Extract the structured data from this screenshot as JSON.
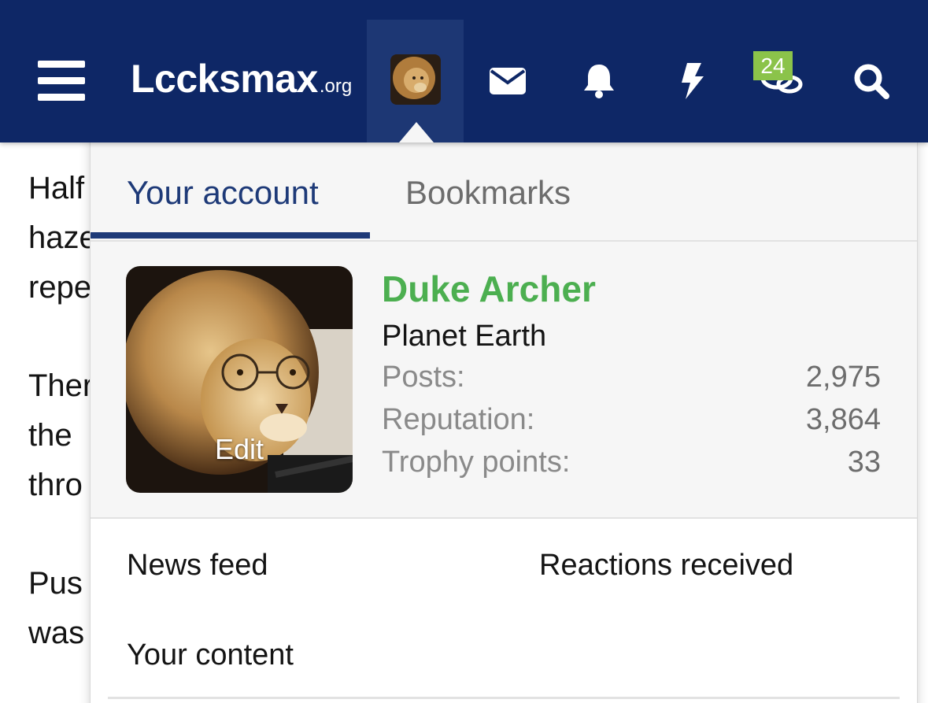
{
  "colors": {
    "navbar_bg": "#0e2766",
    "active_tab_bg": "#1d3774",
    "accent_blue": "#1e3a78",
    "username_green": "#4caf50",
    "badge_green": "#8bc34a",
    "panel_bg": "#f6f6f6"
  },
  "navbar": {
    "menu_icon": "hamburger-icon",
    "logo_text": "Lccksmax",
    "logo_tld": ".org",
    "avatar_icon": "lion-avatar",
    "inbox_icon": "envelope-icon",
    "alerts_icon": "bell-icon",
    "whats_new_icon": "bolt-icon",
    "conversations_icon": "chat-bubbles-icon",
    "conversations_badge": "24",
    "search_icon": "search-icon"
  },
  "article": {
    "lines": [
      "Half",
      "haze",
      "repe",
      "Ther",
      "the",
      "thro",
      "Pus",
      "was"
    ]
  },
  "account_menu": {
    "tabs": [
      {
        "label": "Your account",
        "active": true
      },
      {
        "label": "Bookmarks",
        "active": false
      }
    ],
    "profile": {
      "edit_label": "Edit",
      "username": "Duke Archer",
      "location": "Planet Earth",
      "stats": [
        {
          "label": "Posts:",
          "value": "2,975"
        },
        {
          "label": "Reputation:",
          "value": "3,864"
        },
        {
          "label": "Trophy points:",
          "value": "33"
        }
      ]
    },
    "links": [
      {
        "label": "News feed"
      },
      {
        "label": "Reactions received"
      },
      {
        "label": "Your content"
      }
    ]
  }
}
